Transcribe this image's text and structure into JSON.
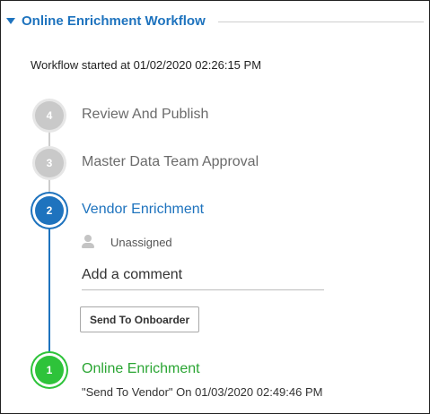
{
  "panel": {
    "title": "Online Enrichment Workflow",
    "started_text": "Workflow started at 01/02/2020 02:26:15 PM"
  },
  "steps": [
    {
      "number": "4",
      "label": "Review And Publish",
      "status": "pending",
      "color": "#c9c9c9"
    },
    {
      "number": "3",
      "label": "Master Data Team Approval",
      "status": "pending",
      "color": "#c9c9c9"
    },
    {
      "number": "2",
      "label": "Vendor Enrichment",
      "status": "current",
      "color": "#1e73be",
      "assignee": "Unassigned",
      "comment_placeholder": "Add a comment",
      "action_label": "Send To Onboarder"
    },
    {
      "number": "1",
      "label": "Online Enrichment",
      "status": "completed",
      "color": "#2ec33a",
      "detail": "\"Send To Vendor\" On 01/03/2020 02:49:46 PM"
    }
  ],
  "icons": {
    "collapse": "caret-down-icon",
    "assignee": "person-icon"
  }
}
